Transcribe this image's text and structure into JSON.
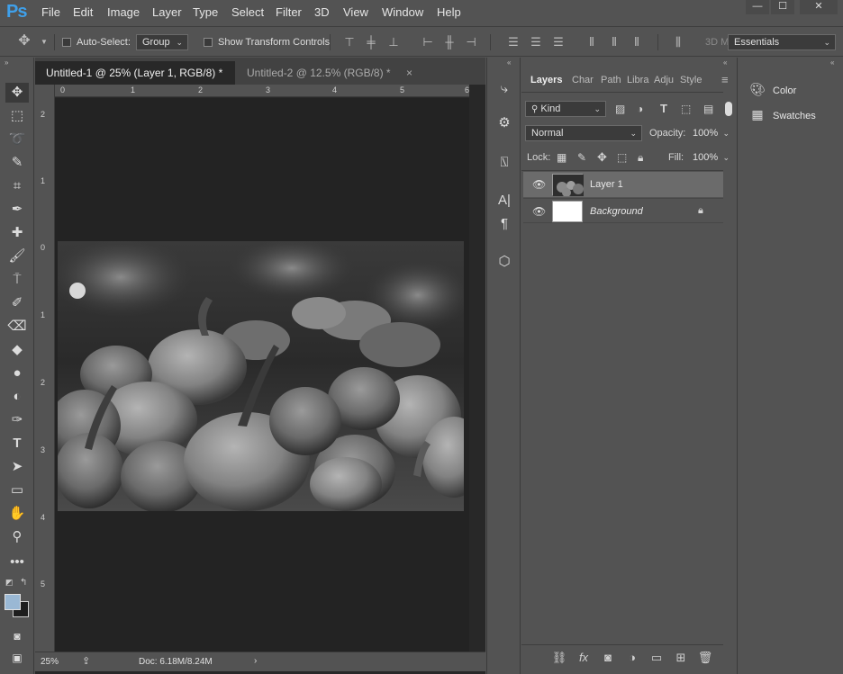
{
  "app": {
    "logo": "Ps"
  },
  "menubar": {
    "items": [
      "File",
      "Edit",
      "Image",
      "Layer",
      "Type",
      "Select",
      "Filter",
      "3D",
      "View",
      "Window",
      "Help"
    ],
    "window_controls": [
      "—",
      "☐",
      "✕"
    ]
  },
  "options": {
    "auto_select_label": "Auto-Select:",
    "auto_select_value": "Group",
    "transform_label": "Show Transform Controls",
    "mode_3d": "3D M",
    "workspace": "Essentials"
  },
  "tabs": [
    {
      "label": "Untitled-1 @ 25% (Layer 1, RGB/8) *",
      "close": "×"
    },
    {
      "label": "Untitled-2 @ 12.5% (RGB/8) *",
      "close": "×"
    }
  ],
  "ruler": {
    "top": [
      "0",
      "1",
      "2",
      "3",
      "4",
      "5",
      "6"
    ],
    "left": [
      "2",
      "1",
      "0",
      "1",
      "2",
      "3",
      "4",
      "5"
    ]
  },
  "status": {
    "zoom": "25%",
    "doc": "Doc: 6.18M/8.24M"
  },
  "layers_panel": {
    "tabs": [
      "Layers",
      "Char",
      "Path",
      "Libra",
      "Adju",
      "Style"
    ],
    "filter_kind": "Kind",
    "blend_mode": "Normal",
    "opacity_label": "Opacity:",
    "opacity_value": "100%",
    "lock_label": "Lock:",
    "fill_label": "Fill:",
    "fill_value": "100%",
    "layers": [
      {
        "name": "Layer 1"
      },
      {
        "name": "Background"
      }
    ]
  },
  "right_panel": {
    "items": [
      {
        "label": "Color",
        "icon": "palette-icon"
      },
      {
        "label": "Swatches",
        "icon": "grid-icon"
      }
    ]
  }
}
